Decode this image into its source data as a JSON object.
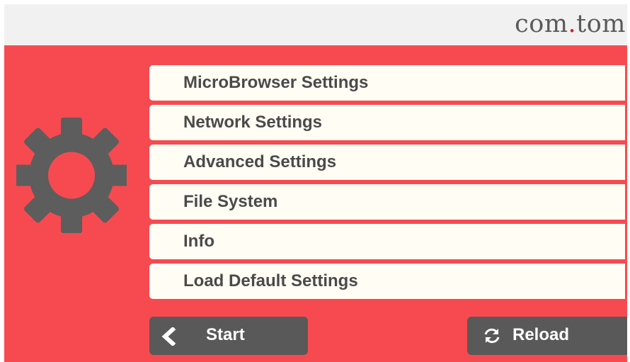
{
  "header": {
    "logo_left": "com",
    "logo_dot": ".",
    "logo_right": "tom"
  },
  "menu": {
    "items": [
      {
        "label": "MicroBrowser Settings"
      },
      {
        "label": "Network Settings"
      },
      {
        "label": "Advanced Settings"
      },
      {
        "label": "File System"
      },
      {
        "label": "Info"
      },
      {
        "label": "Load Default Settings"
      }
    ]
  },
  "footer": {
    "start_label": "Start",
    "reload_label": "Reload"
  },
  "icons": {
    "side": "gear-icon",
    "start": "chevron-left-icon",
    "reload": "refresh-icon"
  },
  "colors": {
    "panel": "#f74a50",
    "header": "#f1f1f1",
    "menu_item": "#fffdf4",
    "button": "#595959",
    "logo_text": "#5a5a5a",
    "logo_dot": "#e2151b",
    "gear": "#5d5d5d"
  }
}
